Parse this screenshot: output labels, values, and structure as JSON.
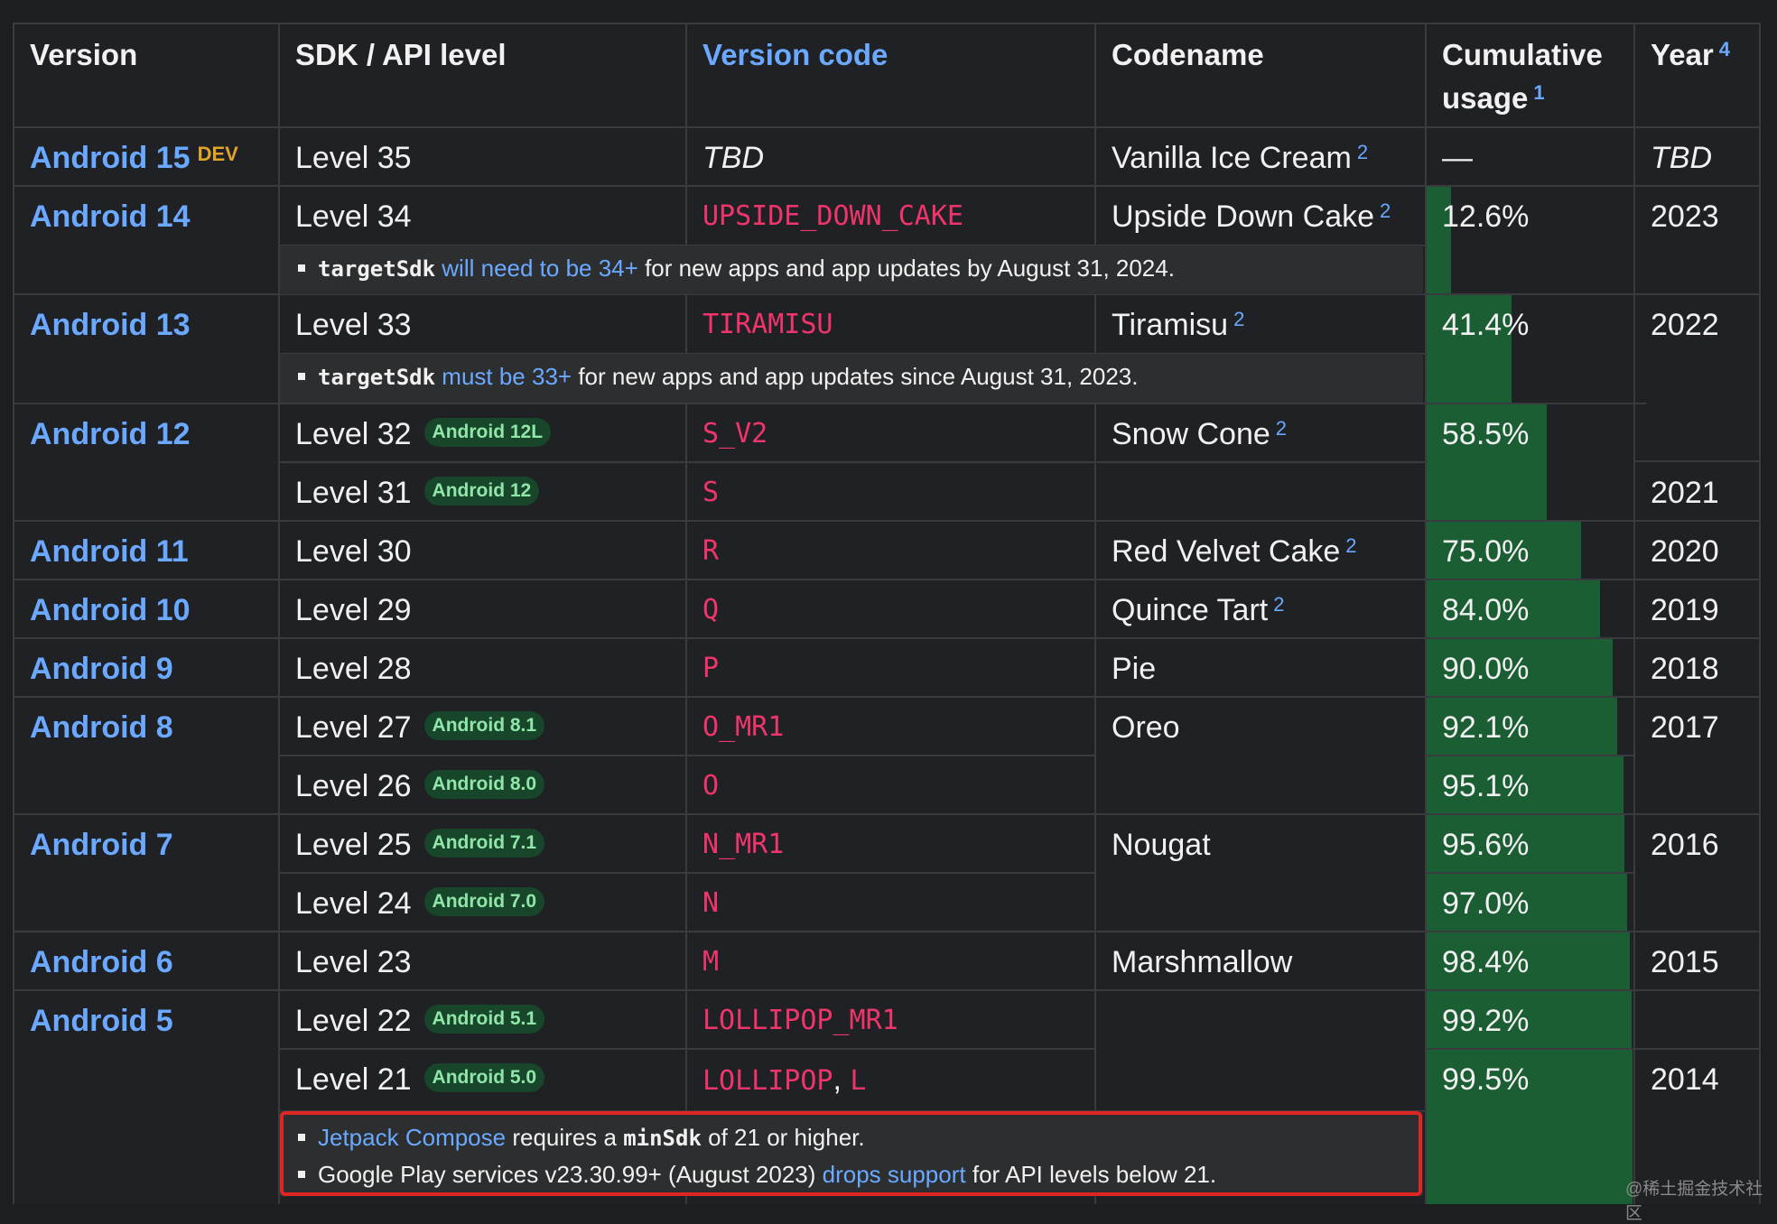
{
  "headers": {
    "version": "Version",
    "sdk": "SDK / API level",
    "code": "Version code",
    "codename": "Codename",
    "usage_line1": "Cumulative",
    "usage_line2": "usage",
    "usage_ref": "1",
    "year": "Year",
    "year_ref": "4"
  },
  "rows": {
    "a15": {
      "version": "Android 15",
      "dev": "DEV",
      "level": "Level 35",
      "code": "TBD",
      "codename": "Vanilla Ice Cream",
      "ref": "2",
      "usage": "—",
      "year": "TBD"
    },
    "a14": {
      "version": "Android 14",
      "level": "Level 34",
      "code": "UPSIDE_DOWN_CAKE",
      "codename": "Upside Down Cake",
      "ref": "2",
      "usage": "12.6%",
      "year": "2023",
      "note_code": "targetSdk",
      "note_link": "will need to be 34+",
      "note_rest": "for new apps and app updates by August 31, 2024."
    },
    "a13": {
      "version": "Android 13",
      "level": "Level 33",
      "code": "TIRAMISU",
      "codename": "Tiramisu",
      "ref": "2",
      "usage": "41.4%",
      "year": "2022",
      "note_code": "targetSdk",
      "note_link": "must be 33+",
      "note_rest": "for new apps and app updates since August 31, 2023."
    },
    "a12": {
      "version": "Android 12",
      "level32": "Level 32",
      "badge32": "Android 12L",
      "code32": "S_V2",
      "level31": "Level 31",
      "badge31": "Android 12",
      "code31": "S",
      "codename": "Snow Cone",
      "ref": "2",
      "usage": "58.5%",
      "year": "2021"
    },
    "a11": {
      "version": "Android 11",
      "level": "Level 30",
      "code": "R",
      "codename": "Red Velvet Cake",
      "ref": "2",
      "usage": "75.0%",
      "year": "2020"
    },
    "a10": {
      "version": "Android 10",
      "level": "Level 29",
      "code": "Q",
      "codename": "Quince Tart",
      "ref": "2",
      "usage": "84.0%",
      "year": "2019"
    },
    "a9": {
      "version": "Android 9",
      "level": "Level 28",
      "code": "P",
      "codename": "Pie",
      "usage": "90.0%",
      "year": "2018"
    },
    "a8": {
      "version": "Android 8",
      "level27": "Level 27",
      "badge27": "Android 8.1",
      "code27": "O_MR1",
      "usage27": "92.1%",
      "level26": "Level 26",
      "badge26": "Android 8.0",
      "code26": "O",
      "usage26": "95.1%",
      "codename": "Oreo",
      "year": "2017"
    },
    "a7": {
      "version": "Android 7",
      "level25": "Level 25",
      "badge25": "Android 7.1",
      "code25": "N_MR1",
      "usage25": "95.6%",
      "level24": "Level 24",
      "badge24": "Android 7.0",
      "code24": "N",
      "usage24": "97.0%",
      "codename": "Nougat",
      "year": "2016"
    },
    "a6": {
      "version": "Android 6",
      "level": "Level 23",
      "code": "M",
      "codename": "Marshmallow",
      "usage": "98.4%",
      "year": "2015"
    },
    "a5": {
      "version": "Android 5",
      "level22": "Level 22",
      "badge22": "Android 5.1",
      "code22": "LOLLIPOP_MR1",
      "usage22": "99.2%",
      "level21": "Level 21",
      "badge21": "Android 5.0",
      "code21a": "LOLLIPOP",
      "code21sep": ",",
      "code21b": "L",
      "usage21": "99.5%",
      "year21": "2014"
    }
  },
  "usage_fractions": {
    "a14": 0.126,
    "a13": 0.414,
    "a12": 0.585,
    "a11": 0.75,
    "a10": 0.84,
    "a9": 0.9,
    "a8_27": 0.921,
    "a8_26": 0.951,
    "a7_25": 0.956,
    "a7_24": 0.97,
    "a6": 0.984,
    "a5_22": 0.992,
    "a5_21": 0.995
  },
  "footnotes": {
    "line1_link": "Jetpack Compose",
    "line1_mid": "requires a",
    "line1_code": "minSdk",
    "line1_rest": "of 21 or higher.",
    "line2_text": "Google Play services v23.30.99+ (August 2023)",
    "line2_link": "drops support",
    "line2_rest": "for API levels below 21."
  },
  "watermark": "@稀土掘金技术社区",
  "colors": {
    "link": "#6aa9ff",
    "code": "#f0346c",
    "usage_bar": "#1b5e34",
    "badge_bg": "#17462a",
    "dev": "#e0a528",
    "highlight_box": "#e02525"
  }
}
